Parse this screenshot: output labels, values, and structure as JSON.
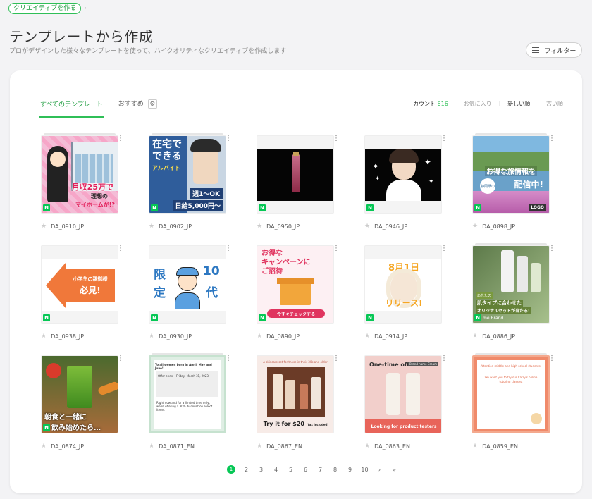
{
  "breadcrumb": {
    "pill": "クリエイティブを作る",
    "chevron": "›"
  },
  "header": {
    "title": "テンプレートから作成",
    "subtitle": "プロがデザインした様々なテンプレートを使って、ハイクオリティなクリエイティブを作成します",
    "filter_label": "フィルター"
  },
  "tabs": [
    {
      "label": "すべてのテンプレート",
      "active": true
    },
    {
      "label": "おすすめ",
      "active": false
    }
  ],
  "count": {
    "label": "カウント",
    "value": "616"
  },
  "sort": {
    "favorites": "お気に入り",
    "newest": "新しい順",
    "oldest": "古い順",
    "sep": "|"
  },
  "icons": {
    "kebab": "⋮",
    "star": "★",
    "gear": "⚙",
    "badge": "N"
  },
  "cards": [
    {
      "name": "DA_0910_JP",
      "t1": "月収25万で",
      "t2": "理想の",
      "t3": "マイホームが!?"
    },
    {
      "name": "DA_0902_JP",
      "t1": "在宅で",
      "t2": "できる",
      "t3": "アルバイト",
      "t4": "週1〜OK",
      "t5": "日給5,000円〜"
    },
    {
      "name": "DA_0950_JP"
    },
    {
      "name": "DA_0946_JP"
    },
    {
      "name": "DA_0898_JP",
      "t1": "お得な旅情報を",
      "t2": "配信中!",
      "t3": "LOGO",
      "t4": "静岡県の"
    },
    {
      "name": "DA_0938_JP",
      "t1": "小学生の親御様",
      "t2": "必見!"
    },
    {
      "name": "DA_0930_JP",
      "t1": "限",
      "t2": "定",
      "t3": "10",
      "t4": "代"
    },
    {
      "name": "DA_0890_JP",
      "t1": "お得な",
      "t2": "キャンペーンに",
      "t3": "ご招待",
      "t4": "今すぐチェックする"
    },
    {
      "name": "DA_0914_JP",
      "t1": "8月1日",
      "t2": "リリース!"
    },
    {
      "name": "DA_0886_JP",
      "t1": "あなたの",
      "t2": "肌タイプに合わせた",
      "t3": "オリジナルセットが当たる!",
      "t4": "me Brand"
    },
    {
      "name": "DA_0874_JP",
      "t1": "朝食と一緒に",
      "t2": "飲み始めたら…"
    },
    {
      "name": "DA_0871_EN",
      "t1": "To all women born in April, May and June!",
      "t2": "Offer ends:",
      "t3": "Friday, March 31, 2023",
      "t4": "Right now and for a limited time only, we're offering a 30% discount on select items."
    },
    {
      "name": "DA_0867_EN",
      "t1": "A skincare set for those in their 30s and older",
      "t2": "Try it for $20",
      "t3": "(tax included)"
    },
    {
      "name": "DA_0863_EN",
      "t1": "One-time offer",
      "t2": "Brand name Cream",
      "t3": "Looking for product testers"
    },
    {
      "name": "DA_0859_EN",
      "t1": "Attention middle and high school students!",
      "t2": "We want you to try our Carry's online tutoring classes."
    }
  ],
  "pagination": {
    "pages": [
      "1",
      "2",
      "3",
      "4",
      "5",
      "6",
      "7",
      "8",
      "9",
      "10"
    ],
    "current": "1",
    "next": "›",
    "last": "»"
  }
}
